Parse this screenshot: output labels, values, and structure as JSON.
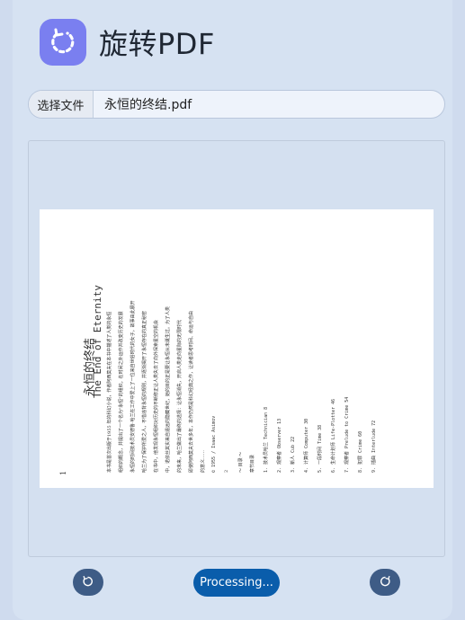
{
  "app": {
    "title": "旋转PDF",
    "logo_icon": "rotate-icon",
    "accent_color": "#7a7ff0"
  },
  "file_picker": {
    "button_label": "选择文件",
    "file_name": "永恒的终结.pdf"
  },
  "preview": {
    "page": {
      "side_number": "1",
      "book_title_cn": "永恒的终结",
      "book_title_en": "The End of Eternity",
      "lines": [
        "本书是首次出版于1955 年的科幻小说，作者阿西莫夫在本书中描述了人类的永恒",
        "组织的概念，并提出了一个名为\"永恒\"的组织，在时间之外运作并改变历史的发展",
        "永恒的时间技术员安德鲁·哈兰在工作中爱上了一位来自世俗时代的女子，故事由此展开",
        "哈兰为了保护所爱之人，不惜违背永恒的规则，并逐渐揭开了永恒存在的真正秘密",
        "在书中，他发现永恒组织对历史的不断修正让人类失去了向外探索星空的机会",
        "中，诺依丝其实来自遥远的隐藏世纪，她的目的正是要让永恒从未诞生过。为了人类",
        "的未来，哈兰做出了最终的选择：让永恒消失，开启人类走向星际的无限时代",
        "即使阿西莫夫去世多年，本作仍然是科幻经典之作，让读者思考时间、命运与自由",
        "的意义……"
      ],
      "copyright": "© 1955 / Isaac Asimov",
      "blank_number": "2",
      "toc_header": "～ 目录 ～",
      "toc_label": "章节目录",
      "toc": [
        "1. 技术员哈兰 Technician 8",
        "2. 观察者 Observer 13",
        "3. 新人 Cub 22",
        "4. 计算师 Computer 30",
        "5. 一段时间 Time 38",
        "6. 生命计划师 Life-Plotter 46",
        "7. 观察者 Prelude to Crime 54",
        "8. 犯罪 Crime 60",
        "9. 插曲 Interlude 72"
      ]
    }
  },
  "controls": {
    "rotate_left_icon": "rotate-counterclockwise-icon",
    "rotate_right_icon": "rotate-clockwise-icon",
    "processing_label": "Processing..."
  }
}
